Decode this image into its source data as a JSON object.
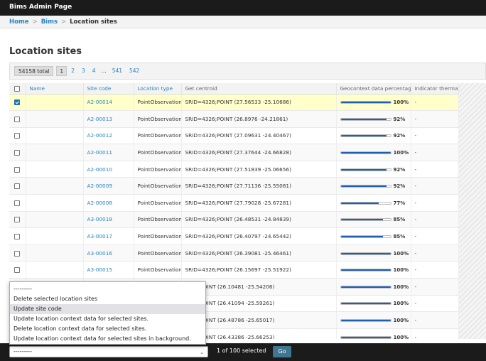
{
  "header": {
    "title": "Bims Admin Page"
  },
  "breadcrumbs": {
    "home": "Home",
    "app": "Bims",
    "sep": ">",
    "current": "Location sites"
  },
  "page_title": "Location sites",
  "paginator": {
    "total": "54158 total",
    "current": "1",
    "pages": [
      "2",
      "3",
      "4"
    ],
    "dots": "...",
    "last_pages": [
      "541",
      "542"
    ]
  },
  "table": {
    "columns": [
      "Name",
      "Site code",
      "Location type",
      "Get centroid",
      "Geocontext data percentage",
      "Indicator thermal"
    ],
    "rows": [
      {
        "name": "",
        "code": "A2-00014",
        "type": "PointObservation",
        "centroid": "SRID=4326;POINT (27.56533 -25.10686)",
        "pct": 100,
        "pct_label": "100%",
        "thermal": "-",
        "selected": true
      },
      {
        "name": "",
        "code": "A2-00013",
        "type": "PointObservation",
        "centroid": "SRID=4326;POINT (26.8976 -24.21861)",
        "pct": 92,
        "pct_label": "92%",
        "thermal": "-",
        "selected": false
      },
      {
        "name": "",
        "code": "A2-00012",
        "type": "PointObservation",
        "centroid": "SRID=4326;POINT (27.09631 -24.40467)",
        "pct": 92,
        "pct_label": "92%",
        "thermal": "-",
        "selected": false
      },
      {
        "name": "",
        "code": "A2-00011",
        "type": "PointObservation",
        "centroid": "SRID=4326;POINT (27.37644 -24.66828)",
        "pct": 100,
        "pct_label": "100%",
        "thermal": "-",
        "selected": false
      },
      {
        "name": "",
        "code": "A2-00010",
        "type": "PointObservation",
        "centroid": "SRID=4326;POINT (27.51839 -25.06656)",
        "pct": 92,
        "pct_label": "92%",
        "thermal": "-",
        "selected": false
      },
      {
        "name": "",
        "code": "A2-00009",
        "type": "PointObservation",
        "centroid": "SRID=4326;POINT (27.71136 -25.55081)",
        "pct": 92,
        "pct_label": "92%",
        "thermal": "-",
        "selected": false
      },
      {
        "name": "",
        "code": "A2-00008",
        "type": "PointObservation",
        "centroid": "SRID=4326;POINT (27.79028 -25.67281)",
        "pct": 77,
        "pct_label": "77%",
        "thermal": "-",
        "selected": false
      },
      {
        "name": "",
        "code": "A3-00018",
        "type": "PointObservation",
        "centroid": "SRID=4326;POINT (26.48531 -24.84839)",
        "pct": 85,
        "pct_label": "85%",
        "thermal": "-",
        "selected": false
      },
      {
        "name": "",
        "code": "A3-00017",
        "type": "PointObservation",
        "centroid": "SRID=4326;POINT (26.40797 -24.65442)",
        "pct": 85,
        "pct_label": "85%",
        "thermal": "-",
        "selected": false
      },
      {
        "name": "",
        "code": "A3-00016",
        "type": "PointObservation",
        "centroid": "SRID=4326;POINT (26.39081 -25.46461)",
        "pct": 100,
        "pct_label": "100%",
        "thermal": "-",
        "selected": false
      },
      {
        "name": "",
        "code": "A3-00015",
        "type": "PointObservation",
        "centroid": "SRID=4326;POINT (26.15697 -25.51922)",
        "pct": 100,
        "pct_label": "100%",
        "thermal": "-",
        "selected": false
      },
      {
        "name": "",
        "code": "",
        "type": "",
        "centroid": "4326;POINT (26.10481 -25.54206)",
        "pct": 100,
        "pct_label": "100%",
        "thermal": "-",
        "selected": false
      },
      {
        "name": "",
        "code": "",
        "type": "",
        "centroid": "4326;POINT (26.41094 -25.59261)",
        "pct": 100,
        "pct_label": "100%",
        "thermal": "-",
        "selected": false
      },
      {
        "name": "",
        "code": "",
        "type": "",
        "centroid": "4326;POINT (26.48786 -25.65017)",
        "pct": 100,
        "pct_label": "100%",
        "thermal": "-",
        "selected": false
      },
      {
        "name": "",
        "code": "",
        "type": "",
        "centroid": "4326;POINT (26.43386 -25.66253)",
        "pct": 100,
        "pct_label": "100%",
        "thermal": "-",
        "selected": false
      }
    ]
  },
  "actions": {
    "options": [
      "---------",
      "Delete selected location sites",
      "Update site code",
      "Update location context data for selected sites.",
      "Delete location context data for selected sites.",
      "Update location context data for selected sites in background."
    ],
    "highlighted_index": 2,
    "selected_value": "---------",
    "chevron": "⌄",
    "selected_count": "1 of 100 selected",
    "go_label": "Go"
  },
  "colors": {
    "header_bg": "#1b1b1b",
    "link": "#2784c2",
    "bar_fill": "#1e5fb4",
    "selected_row": "#ffffcc",
    "go_button": "#417690"
  }
}
